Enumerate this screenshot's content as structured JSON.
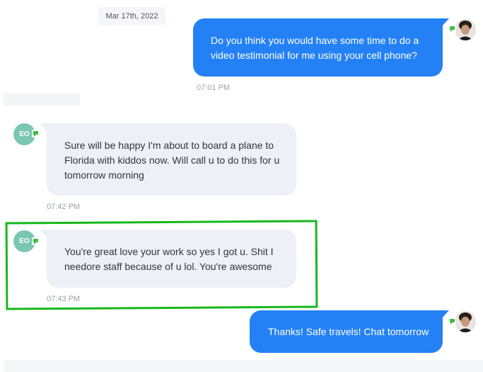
{
  "conversation": {
    "date_separator": "Mar 17th, 2022",
    "messages": [
      {
        "direction": "outgoing",
        "text": "Do you think you would have some time to do a video testimonial for me using your cell phone?",
        "time": "07:01 PM",
        "avatar": "user-photo"
      },
      {
        "direction": "incoming",
        "text": "Sure will be happy  I'm about to board a plane to Florida with kiddos now. Will call u to do this for u tomorrow morning",
        "time": "07:42 PM",
        "avatar_initials": "EO"
      },
      {
        "direction": "incoming",
        "text": "You're great love your work so yes I got u. Shit I needore staff because of u lol. You're awesome",
        "time": "07:43 PM",
        "avatar_initials": "EO",
        "highlighted": true
      },
      {
        "direction": "outgoing",
        "text": "Thanks! Safe travels! Chat tomorrow",
        "time": "",
        "avatar": "user-photo"
      }
    ]
  },
  "colors": {
    "outgoing_bubble": "#2481f5",
    "incoming_bubble": "#eef0f7",
    "avatar_initials_bg": "#7bc6b3",
    "channel_badge": "#3bbf3f",
    "highlight_border": "#16b81b"
  },
  "icons": {
    "channel": "sms-message-icon",
    "avatar": "user-photo-avatar"
  }
}
